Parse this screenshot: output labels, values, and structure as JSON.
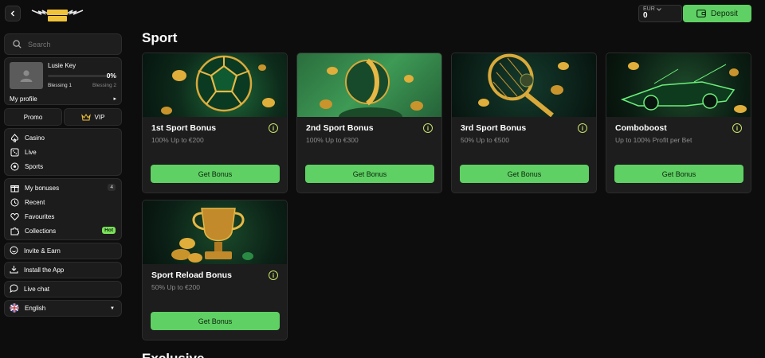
{
  "header": {
    "logo_text": "HOLY LUCK",
    "currency": "EUR",
    "balance": "0",
    "deposit_label": "Deposit"
  },
  "sidebar": {
    "search_placeholder": "Search",
    "profile": {
      "name": "Lusie Key",
      "progress_percent": "0%",
      "progress_fraction": 0,
      "level_current": "Blessing 1",
      "level_next": "Blessing 2",
      "my_profile": "My profile"
    },
    "promo_label": "Promo",
    "vip_label": "VIP",
    "main_nav": [
      {
        "label": "Casino",
        "icon": "spade-icon"
      },
      {
        "label": "Live",
        "icon": "dice-icon"
      },
      {
        "label": "Sports",
        "icon": "ball-icon"
      }
    ],
    "personal_nav": [
      {
        "label": "My bonuses",
        "icon": "gift-icon",
        "badge": "4"
      },
      {
        "label": "Recent",
        "icon": "clock-icon"
      },
      {
        "label": "Favourites",
        "icon": "heart-icon"
      },
      {
        "label": "Collections",
        "icon": "puzzle-icon",
        "badge": "Hot"
      }
    ],
    "invite_label": "Invite & Earn",
    "install_label": "Install the App",
    "live_chat_label": "Live chat",
    "language": "English"
  },
  "main": {
    "heading": "Sport",
    "next_heading": "Exclusive",
    "cards": [
      {
        "title": "1st Sport Bonus",
        "subtitle": "100% Up to €200",
        "button": "Get Bonus"
      },
      {
        "title": "2nd Sport Bonus",
        "subtitle": "100% Up to €300",
        "button": "Get Bonus"
      },
      {
        "title": "3rd Sport Bonus",
        "subtitle": "50% Up to €500",
        "button": "Get Bonus"
      },
      {
        "title": "Comboboost",
        "subtitle": "Up to 100% Profit per Bet",
        "button": "Get Bonus"
      },
      {
        "title": "Sport Reload Bonus",
        "subtitle": "50% Up to €200",
        "button": "Get Bonus"
      }
    ]
  },
  "colors": {
    "accent_green": "#5fd063",
    "info_yellow": "#c8e46a",
    "background": "#0d0d0d",
    "panel": "#1c1c1c"
  }
}
